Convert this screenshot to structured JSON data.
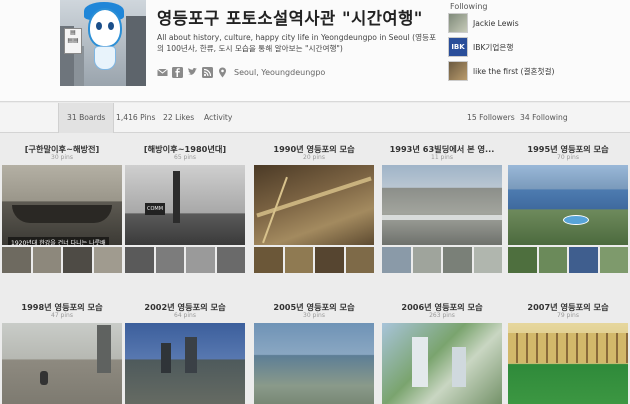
{
  "profile": {
    "name": "영등포구 포토소설역사관 \"시간여행\"",
    "about": "All about history, culture, happy city life in Yeongdeungpo in Seoul (영등포의 100년사, 한류, 도시 모습을 통해 알아보는 \"시간여행\")",
    "location": "Seoul, Yeoungdeungpo"
  },
  "following_panel": {
    "title": "Following",
    "items": [
      {
        "name": "Jackie Lewis"
      },
      {
        "name": "IBK기업은행"
      },
      {
        "name": "like the first (결혼첫걸)"
      }
    ]
  },
  "stats": {
    "boards": "31 Boards",
    "pins": "1,416 Pins",
    "likes": "22 Likes",
    "activity": "Activity",
    "followers": "15 Followers",
    "following": "34 Following"
  },
  "boards_row1": [
    {
      "title": "[구한말이후~해방전]",
      "pins": "30 pins"
    },
    {
      "title": "[해방이후~1980년대]",
      "pins": "65 pins"
    },
    {
      "title": "1990년 영등포의 모습",
      "pins": "20 pins"
    },
    {
      "title": "1993년 63빌딩에서 본 영...",
      "pins": "11 pins"
    },
    {
      "title": "1995년 영등포의 모습",
      "pins": "70 pins"
    }
  ],
  "boards_row2": [
    {
      "title": "1998년 영등포의 모습",
      "pins": "47 pins"
    },
    {
      "title": "2002년 영등포의 모습",
      "pins": "64 pins"
    },
    {
      "title": "2005년 영등포의 모습",
      "pins": "30 pins"
    },
    {
      "title": "2006년 영등포의 모습",
      "pins": "263 pins"
    },
    {
      "title": "2007년 영등포의 모습",
      "pins": "79 pins"
    }
  ],
  "cover_captions": {
    "board1": "1920년대 한강을 건너 다니는 나룻배",
    "board2_sign": "COMM"
  },
  "colors": {
    "brand_blue": "#1f86d8",
    "text_dark": "#222222",
    "muted": "#999999"
  },
  "icons": [
    "mail-icon",
    "facebook-icon",
    "twitter-icon",
    "rss-icon",
    "location-pin-icon"
  ]
}
